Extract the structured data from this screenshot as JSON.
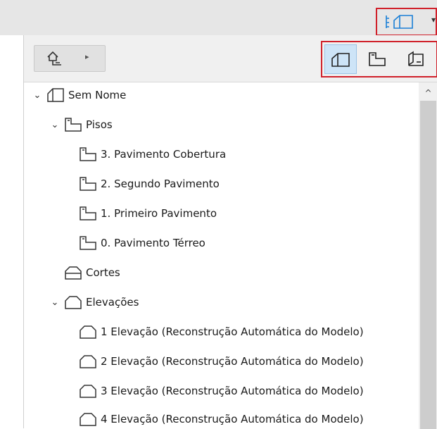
{
  "top_bar": {
    "view_menu_arrow": "▾"
  },
  "toolbar": {
    "nav_arrow": "▸",
    "scroll_up": "^"
  },
  "tree": {
    "root": {
      "label": "Sem Nome",
      "expanded": true,
      "icon": "project-icon"
    },
    "floors": {
      "label": "Pisos",
      "expanded": true,
      "icon": "floor-plan-icon",
      "items": [
        "3. Pavimento Cobertura",
        "2. Segundo Pavimento",
        "1. Primeiro Pavimento",
        "0. Pavimento Térreo"
      ]
    },
    "sections": {
      "label": "Cortes",
      "icon": "section-icon"
    },
    "elevations": {
      "label": "Elevações",
      "expanded": true,
      "icon": "elevation-icon",
      "items": [
        "1 Elevação (Reconstrução Automática do Modelo)",
        "2 Elevação (Reconstrução Automática do Modelo)",
        "3 Elevação (Reconstrução Automática do Modelo)",
        "4 Elevação (Reconstrução Automática do Modelo)"
      ]
    }
  },
  "colors": {
    "highlight_border": "#d0202a",
    "active_view": "#cde4f7",
    "accent_icon": "#1a7fd6"
  }
}
